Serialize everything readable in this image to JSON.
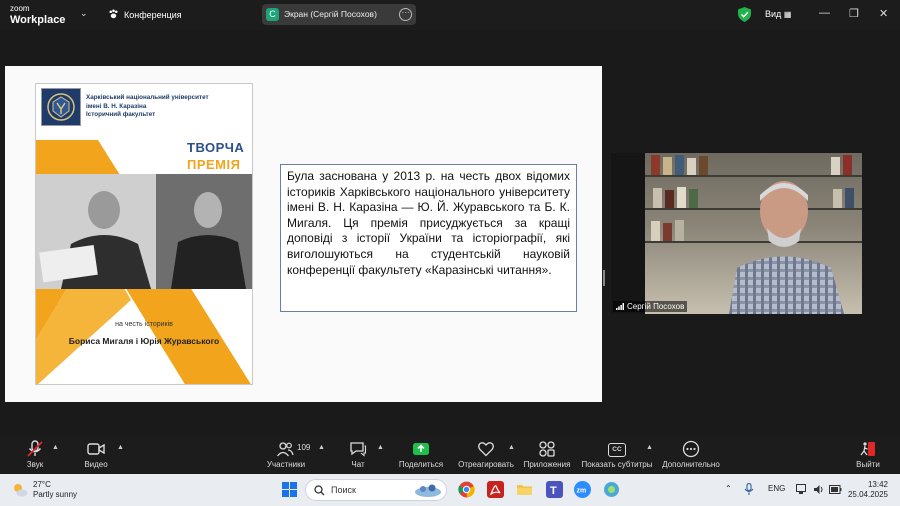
{
  "topbar": {
    "brand_top": "zoom",
    "brand_bottom": "Workplace",
    "meeting_label": "Конференция",
    "share_badge": "С",
    "share_title": "Экран (Сергій Посохов)",
    "view_label": "Вид",
    "accent": "#1fa37a"
  },
  "slide": {
    "cover": {
      "uni_line1": "Харківський національний університет",
      "uni_line2": "імені В. Н. Каразіна",
      "uni_line3": "Історичний факультет",
      "title1": "ТВОРЧА",
      "title2": "ПРЕМІЯ",
      "honor": "на честь істориків",
      "names": "Бориса Мигаля і Юрія Журавського"
    },
    "text": "Була заснована у 2013 р. на честь двох відомих істориків Харківського національного університету імені В. Н. Каразіна — Ю. Й. Журавського та Б. К. Мигаля. Ця премія присуджується за кращі доповіді з історії України та історіографії, які виголошуються на студентській науковій конференції факультету «Каразінські читання»."
  },
  "video": {
    "participant": "Сергій Посохов"
  },
  "toolbar": {
    "audio": "Звук",
    "video": "Видео",
    "participants": "Участники",
    "participants_count": "109",
    "chat": "Чат",
    "share": "Поделиться",
    "react": "Отреагировать",
    "apps": "Приложения",
    "captions": "Показать субтитры",
    "cc": "CC",
    "more": "Дополнительно",
    "leave": "Выйти",
    "share_color": "#1fbf4c",
    "leave_color": "#e02828"
  },
  "taskbar": {
    "temp": "27°C",
    "weather": "Partly sunny",
    "search": "Поиск",
    "lang": "ENG",
    "time": "13:42",
    "date": "25.04.2025"
  }
}
